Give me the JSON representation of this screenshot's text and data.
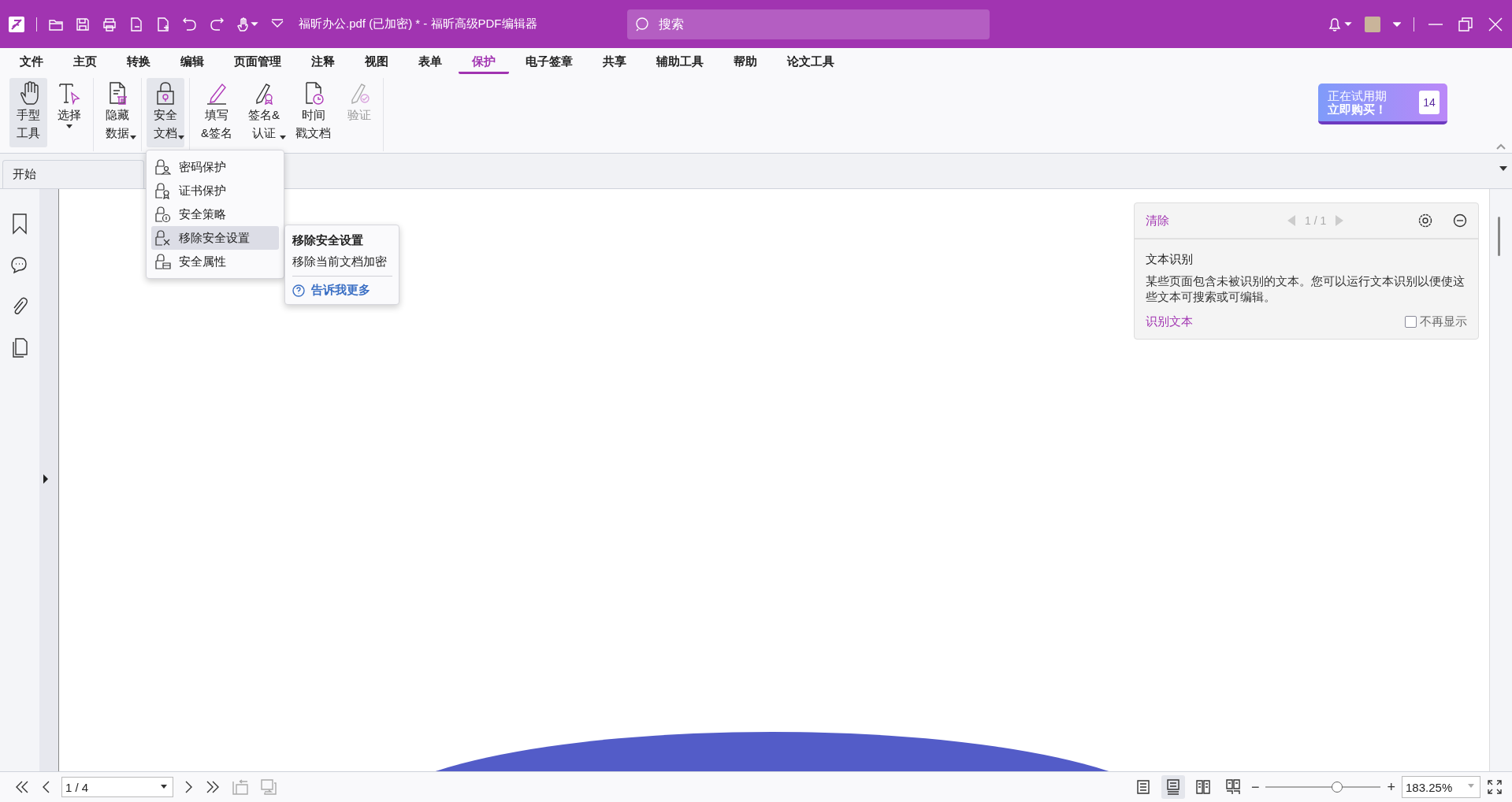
{
  "title_bar": {
    "title": "福昕办公.pdf (已加密) * - 福昕高级PDF编辑器",
    "search_placeholder": "搜索"
  },
  "menu": [
    {
      "label": "文件",
      "selected": false
    },
    {
      "label": "主页",
      "selected": false
    },
    {
      "label": "转换",
      "selected": false
    },
    {
      "label": "编辑",
      "selected": false
    },
    {
      "label": "页面管理",
      "selected": false
    },
    {
      "label": "注释",
      "selected": false
    },
    {
      "label": "视图",
      "selected": false
    },
    {
      "label": "表单",
      "selected": false
    },
    {
      "label": "保护",
      "selected": true
    },
    {
      "label": "电子签章",
      "selected": false
    },
    {
      "label": "共享",
      "selected": false
    },
    {
      "label": "辅助工具",
      "selected": false
    },
    {
      "label": "帮助",
      "selected": false
    },
    {
      "label": "论文工具",
      "selected": false
    }
  ],
  "ribbon": {
    "groups": [
      {
        "tools": [
          {
            "kind": "hand",
            "lines": [
              "手型",
              "工具"
            ],
            "dropdown": false,
            "selected": true,
            "disabled": false
          },
          {
            "kind": "select",
            "lines": [
              "选择"
            ],
            "dropdown": true,
            "selected": false,
            "disabled": false
          }
        ]
      },
      {
        "tools": [
          {
            "kind": "hide",
            "lines": [
              "隐藏",
              "数据"
            ],
            "dropdown": true,
            "selected": false,
            "disabled": false
          }
        ]
      },
      {
        "tools": [
          {
            "kind": "lock",
            "lines": [
              "安全",
              "文档"
            ],
            "dropdown": true,
            "selected": true,
            "disabled": false
          }
        ]
      },
      {
        "tools": [
          {
            "kind": "pen",
            "lines": [
              "填写",
              "&签名"
            ],
            "dropdown": false,
            "selected": false,
            "disabled": false
          },
          {
            "kind": "sign",
            "lines": [
              "签名&",
              "认证"
            ],
            "dropdown": true,
            "selected": false,
            "disabled": false
          },
          {
            "kind": "clock",
            "lines": [
              "时间",
              "戳文档"
            ],
            "dropdown": false,
            "selected": false,
            "disabled": false
          },
          {
            "kind": "verify",
            "lines": [
              "验证"
            ],
            "dropdown": false,
            "selected": false,
            "disabled": true
          }
        ]
      }
    ]
  },
  "trial": {
    "line1": "正在试用期",
    "line2": "立即购买！",
    "days": "14"
  },
  "doc_tabs": [
    {
      "label": "开始"
    }
  ],
  "security_menu": [
    {
      "kind": "user",
      "label": "密码保护",
      "selected": false
    },
    {
      "kind": "cert",
      "label": "证书保护",
      "selected": false
    },
    {
      "kind": "policy",
      "label": "安全策略",
      "selected": false
    },
    {
      "kind": "remove",
      "label": "移除安全设置",
      "selected": true
    },
    {
      "kind": "props",
      "label": "安全属性",
      "selected": false
    }
  ],
  "tooltip": {
    "title": "移除安全设置",
    "description": "移除当前文档加密",
    "link": "告诉我更多"
  },
  "ocr_panel": {
    "clear": "清除",
    "page": "1 / 1",
    "title": "文本识别",
    "body": "某些页面包含未被识别的文本。您可以运行文本识别以便使这些文本可搜索或可编辑。",
    "action": "识别文本",
    "dont_show": {
      "label": "不再显示",
      "checked": false
    }
  },
  "status_bar": {
    "page": "1 / 4",
    "view_modes": [
      {
        "kind": "single",
        "selected": false
      },
      {
        "kind": "continuous",
        "selected": true
      },
      {
        "kind": "facing",
        "selected": false
      },
      {
        "kind": "cont-facing",
        "selected": false
      }
    ],
    "zoom_minus": "−",
    "zoom_plus": "+",
    "zoom": {
      "level": 0.62
    },
    "zoom_value": "183.25%"
  }
}
